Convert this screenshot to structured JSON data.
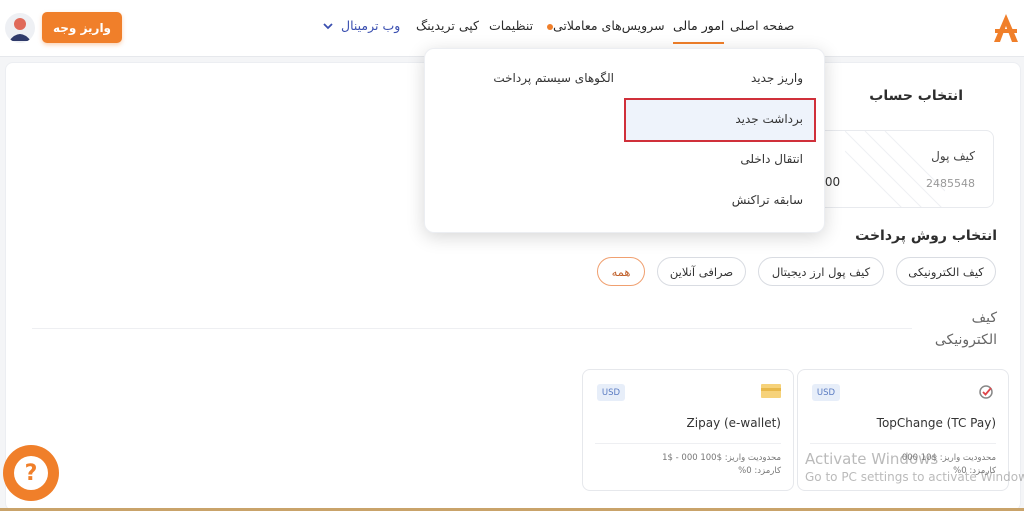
{
  "header": {
    "nav": {
      "home": "صفحه اصلی",
      "finance": "امور مالی",
      "trading_services": "سرویس‌های معاملاتی",
      "settings": "تنظیمات",
      "copy_trading": "کپی تریدینگ",
      "web_terminal": "وب ترمینال"
    },
    "deposit_button": "واریز وجه"
  },
  "dropdown": {
    "items": [
      "واریز جدید",
      "برداشت جدید",
      "انتقال داخلی",
      "سابقه تراکنش"
    ],
    "side_link": "الگوهای سیستم پرداخت"
  },
  "account": {
    "title": "انتخاب حساب",
    "wallet_name": "کیف پول",
    "wallet_number": "2485548",
    "wallet_balance": ".00"
  },
  "payment": {
    "title": "انتخاب روش پرداخت",
    "filters": [
      "کیف الکترونیکی",
      "کیف پول ارز دیجیتال",
      "صرافی آنلاین",
      "همه"
    ],
    "category_label": "کیف الکترونیکی"
  },
  "methods": [
    {
      "name": "TopChange (TC Pay)",
      "currency": "USD",
      "limit": "محدودیت واریز: $10 000",
      "fee": "کارمزد: 0%"
    },
    {
      "name": "Zipay (e-wallet)",
      "currency": "USD",
      "limit": "محدودیت واریز: $100 000 - $1",
      "fee": "کارمزد: 0%"
    }
  ],
  "help_icon": "?",
  "watermark": {
    "line1": "Activate Windows",
    "line2": "Go to PC settings to activate Windows."
  },
  "colors": {
    "accent": "#f07f2a",
    "highlight_border": "#d0303a",
    "nav_link": "#3a4fb0"
  }
}
